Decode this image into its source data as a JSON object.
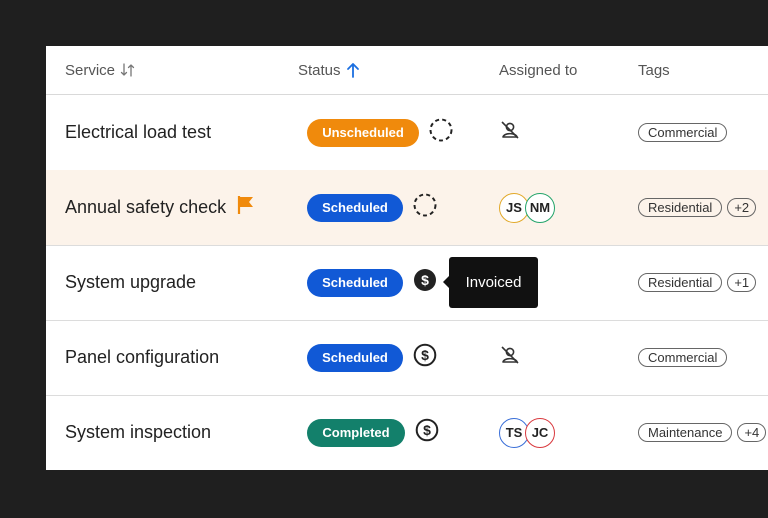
{
  "header": {
    "service": "Service",
    "status": "Status",
    "assigned": "Assigned to",
    "tags": "Tags"
  },
  "rows": [
    {
      "service": "Electrical load test",
      "status": "Unscheduled",
      "status_icon": "dashed-circle-icon",
      "assignees": [],
      "tags": [
        "Commercial"
      ],
      "tags_more": ""
    },
    {
      "service": "Annual safety check",
      "flag": "flag-icon",
      "status": "Scheduled",
      "status_icon": "dashed-circle-icon",
      "assignees": [
        "JS",
        "NM"
      ],
      "tags": [
        "Residential"
      ],
      "tags_more": "+2"
    },
    {
      "service": "System upgrade",
      "status": "Scheduled",
      "status_icon": "dollar-filled-icon",
      "assignees": [],
      "tags": [
        "Residential"
      ],
      "tags_more": "+1"
    },
    {
      "service": "Panel configuration",
      "status": "Scheduled",
      "status_icon": "dollar-outline-icon",
      "assignees": [],
      "tags": [
        "Commercial"
      ],
      "tags_more": ""
    },
    {
      "service": "System inspection",
      "status": "Completed",
      "status_icon": "dollar-outline-icon",
      "assignees": [
        "TS",
        "JC"
      ],
      "tags": [
        "Maintenance"
      ],
      "tags_more": "+4"
    }
  ],
  "tooltip": "Invoiced",
  "colors": {
    "unscheduled": "#f08a0c",
    "scheduled": "#1159d6",
    "completed": "#13806b",
    "flag": "#f08a0c",
    "sort_active": "#1b6fe0",
    "avatar_JS": "#e2a92a",
    "avatar_NM": "#23a46a",
    "avatar_TS": "#3a6fd8",
    "avatar_JC": "#d9393e"
  }
}
